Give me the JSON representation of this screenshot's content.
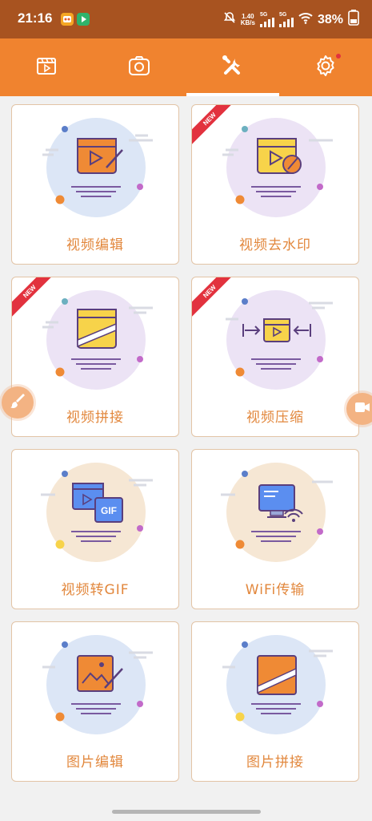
{
  "status_bar": {
    "time": "21:16",
    "net_speed_value": "1.40",
    "net_speed_unit": "KB/s",
    "signal1_label": "5G",
    "signal2_label": "5G",
    "battery_percent": "38%"
  },
  "tabs": [
    {
      "name": "video",
      "icon": "video-clapper-icon",
      "selected": false
    },
    {
      "name": "camera",
      "icon": "camera-icon",
      "selected": false
    },
    {
      "name": "tools",
      "icon": "tools-icon",
      "selected": true
    },
    {
      "name": "settings",
      "icon": "settings-gear-icon",
      "selected": false,
      "badge": true
    }
  ],
  "badge_new": "NEW",
  "cards": [
    {
      "label": "视频编辑",
      "icon": "video-edit-icon",
      "is_new": false
    },
    {
      "label": "视频去水印",
      "icon": "video-watermark-remove-icon",
      "is_new": true
    },
    {
      "label": "视频拼接",
      "icon": "video-merge-icon",
      "is_new": true
    },
    {
      "label": "视频压缩",
      "icon": "video-compress-icon",
      "is_new": true
    },
    {
      "label": "视频转GIF",
      "icon": "video-to-gif-icon",
      "is_new": false
    },
    {
      "label": "WiFi传输",
      "icon": "wifi-transfer-icon",
      "is_new": false
    },
    {
      "label": "图片编辑",
      "icon": "image-edit-icon",
      "is_new": false
    },
    {
      "label": "图片拼接",
      "icon": "image-merge-icon",
      "is_new": false
    }
  ],
  "gif_badge_text": "GIF",
  "colors": {
    "status_bar_bg": "#a85320",
    "tab_bar_bg": "#f0832f",
    "card_label": "#e2873c",
    "new_ribbon": "#e2323e",
    "icon_orange": "#ef8a35",
    "icon_yellow": "#f7d34a",
    "icon_blue": "#5b8ef0"
  }
}
